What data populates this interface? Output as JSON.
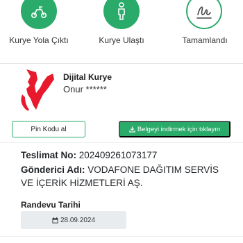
{
  "steps": [
    {
      "label": "Kurye Yola Çıktı",
      "icon": "scooter-icon",
      "status": "done"
    },
    {
      "label": "Kurye Ulaştı",
      "icon": "person-icon",
      "status": "done"
    },
    {
      "label": "Tamamlandı",
      "icon": "signature-icon",
      "status": "pending"
    }
  ],
  "courier": {
    "title": "Dijital Kurye",
    "name": "Onur ******"
  },
  "buttons": {
    "pin_label": "Pin Kodu al",
    "download_label": "Belgeyi indirmek için tıklayın",
    "download_icon": "download-icon"
  },
  "shipment": {
    "tracking_label": "Teslimat No:",
    "tracking_value": "202409261073177",
    "sender_label": "Gönderici Adı:",
    "sender_value": "VODAFONE DAĞITIM SERVİS VE İÇERİK HİZMETLERİ AŞ."
  },
  "appointment": {
    "title": "Randevu Tarihi",
    "date": "28.09.2024",
    "icon": "calendar-icon"
  },
  "colors": {
    "accent": "#2bab6a",
    "avatar_mark": "#e8192c"
  }
}
